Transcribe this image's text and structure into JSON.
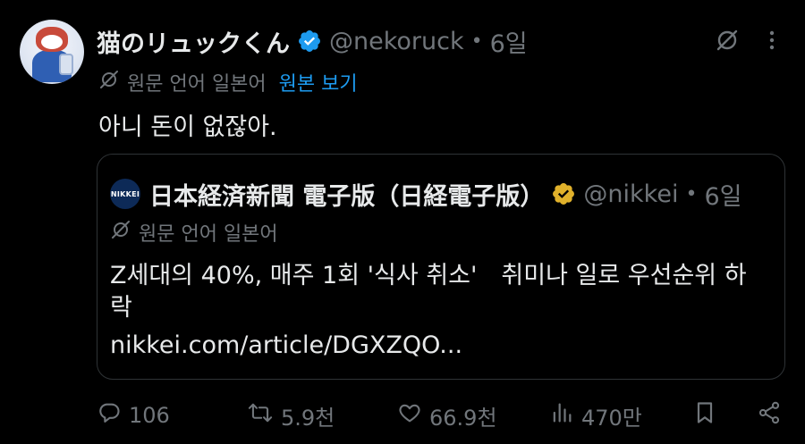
{
  "author": {
    "display_name": "猫のリュックくん",
    "handle": "@nekoruck",
    "separator": "•",
    "time": "6일",
    "avatar_icon": "cat-backpack-avatar",
    "verified_color": "#1d9bf0"
  },
  "translation": {
    "icon": "translate-icon",
    "label": "원문 언어 일본어",
    "show_original": "원본 보기",
    "accent_color": "#1d9bf0"
  },
  "tweet": {
    "text": "아니 돈이 없잖아."
  },
  "quote": {
    "avatar_text": "NIKKEI",
    "display_name": "日本経済新聞 電子版（日経電子版）",
    "handle": "@nikkei",
    "separator": "•",
    "time": "6일",
    "verified_color": "#e0b12b",
    "translation_label": "원문 언어 일본어",
    "text": "Z세대의 40%, 매주 1회 '식사 취소'　취미나 일로 우선순위 하락",
    "link": "nikkei.com/article/DGXZQO..."
  },
  "actions": {
    "reply_count": "106",
    "retweet_count": "5.9천",
    "like_count": "66.9천",
    "views_count": "470만"
  }
}
